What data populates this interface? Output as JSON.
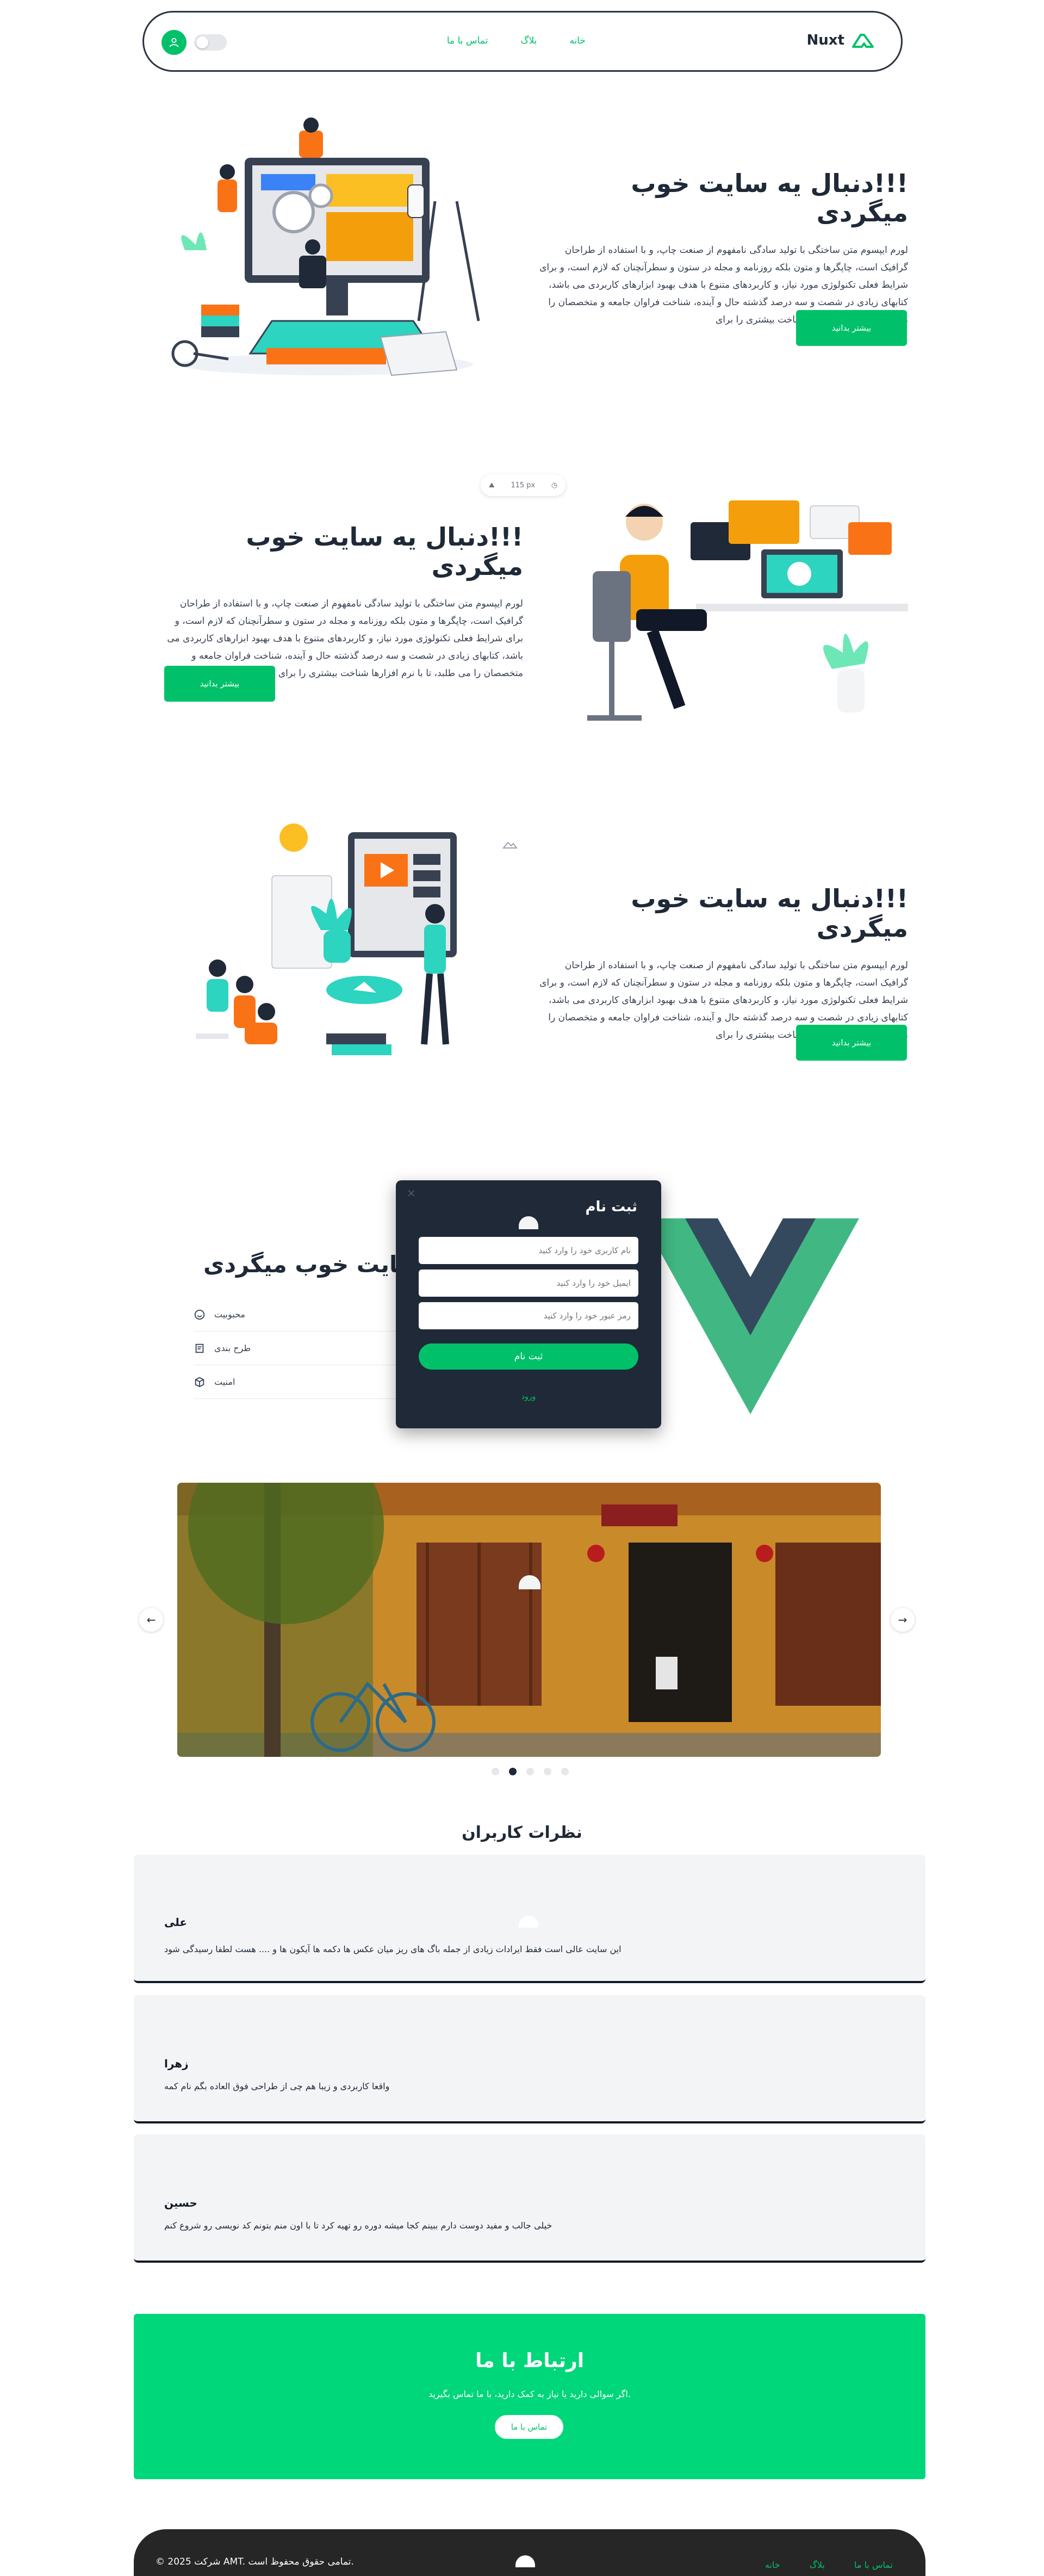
{
  "nav": {
    "brand": "Nuxt",
    "links": [
      "خانه",
      "بلاگ",
      "تماس با ما"
    ]
  },
  "hero": {
    "title": "!!!دنبال یه سایت خوب میگردی",
    "body": "لورم ایپسوم متن ساختگی با تولید سادگی نامفهوم از صنعت چاپ، و با استفاده از طراحان گرافیک است، چاپگرها و متون بلکه روزنامه و مجله در ستون و سطرآنچنان که لازم است، و برای شرایط فعلی تکنولوژی مورد نیاز، و کاربردهای متنوع با هدف بهبود ابزارهای کاربردی می باشد، کتابهای زیادی در شصت و سه درصد گذشته حال و آینده، شناخت فراوان جامعه و متخصصان را می طلبد، تا با نرم افزارها شناخت بیشتری را برای",
    "button": "بیشتر بدانید"
  },
  "zoom_chip": {
    "value": "115",
    "unit": "px"
  },
  "features": {
    "title": "دنبال یه سایت خوب میگردی",
    "items": [
      "محبوبیت",
      "طرح بندی",
      "امنیت"
    ]
  },
  "signup": {
    "title": "ثبت نام",
    "username_placeholder": "نام کاربری خود را وارد کنید",
    "email_placeholder": "ایمیل خود را وارد کنید",
    "password_placeholder": "رمز عبور خود را وارد کنید",
    "submit": "ثبت نام",
    "login_link": "ورود"
  },
  "carousel": {
    "total_slides": 5,
    "active_slide": 2
  },
  "comments": {
    "title": "نظرات کاربران",
    "items": [
      {
        "name": "علی",
        "text": "این سایت عالی است فقط ایرادات زیادی از جمله باگ های ریز میان عکس ها دکمه ها آیکون ها و .... هست لطفا رسیدگی شود"
      },
      {
        "name": "زهرا",
        "text": "واقعا کاربردی و زیبا هم چی از طراحی فوق العاده بگم نام کمه"
      },
      {
        "name": "حسین",
        "text": "خیلی جالب و مفید دوست دارم ببینم کجا میشه دوره رو تهیه کرد تا با اون منم بتونم کد نویسی رو شروع کنم"
      }
    ]
  },
  "contact": {
    "title": "ارتباط با ما",
    "subtitle": "اگر سوالی دارید یا نیاز به کمک دارید، با ما تماس بگیرید.",
    "button": "تماس با ما"
  },
  "footer": {
    "copyright": "© 2025 شرکت AMT. تمامی حقوق محفوظ است.",
    "links": [
      "خانه",
      "بلاگ",
      "تماس با ما"
    ]
  },
  "colors": {
    "accent": "#00c16a",
    "dark": "#1f2937",
    "contact_bg": "#00d67a",
    "footer_bg": "#262626",
    "comment_bg": "#f3f4f6"
  }
}
